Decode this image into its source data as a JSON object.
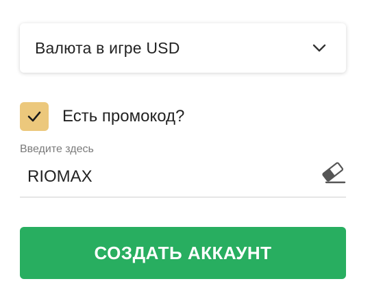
{
  "currency_select": {
    "value": "Валюта в игре USD",
    "icon": "chevron-down-icon"
  },
  "promo": {
    "checked": true,
    "checkbox_icon": "checkmark-icon",
    "checkbox_color": "#ecc87c",
    "label": "Есть промокод?",
    "input_label": "Введите здесь",
    "input_value": "RIOMAX",
    "clear_icon": "eraser-icon"
  },
  "submit": {
    "label": "СОЗДАТЬ АККАУНТ",
    "color": "#28ae60"
  }
}
